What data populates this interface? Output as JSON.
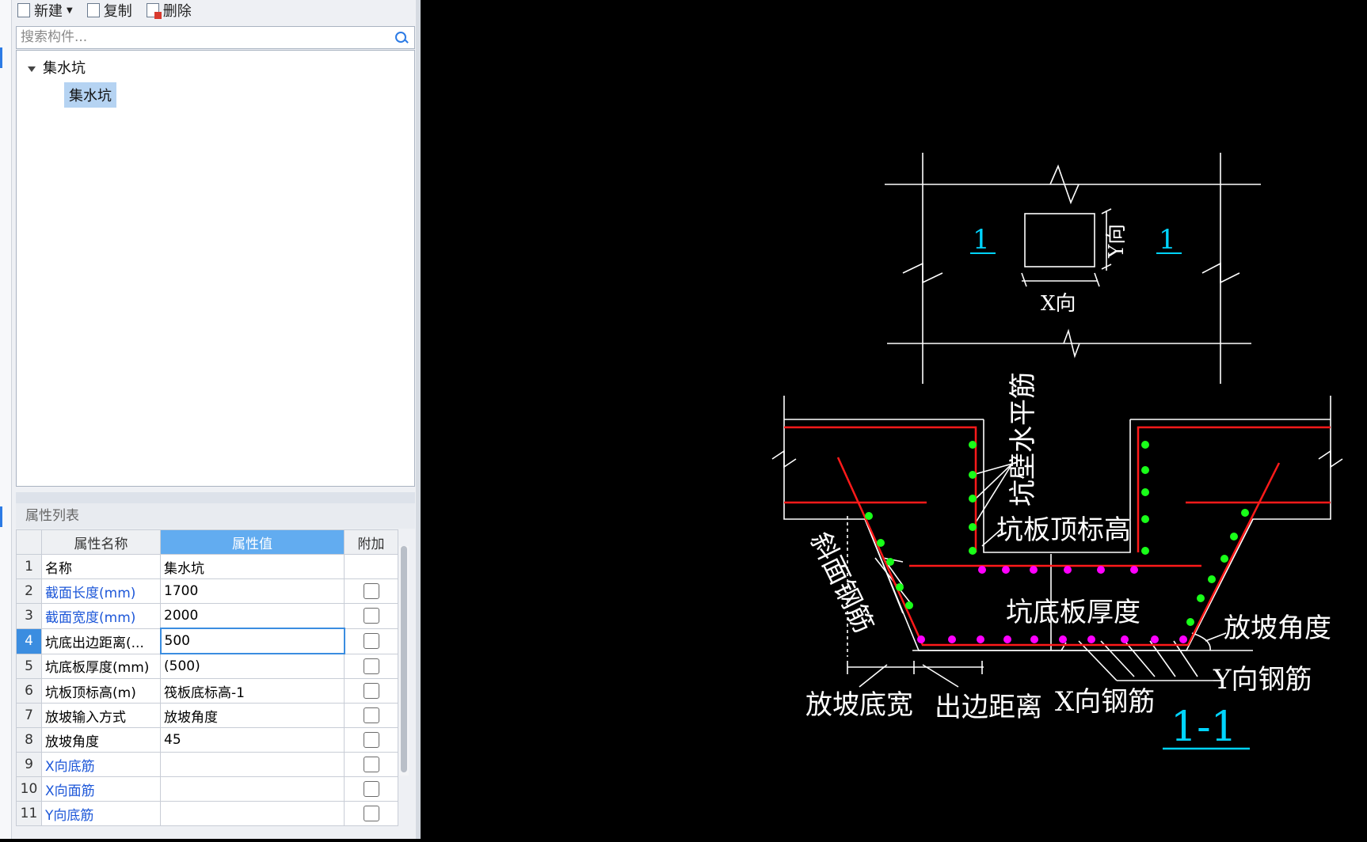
{
  "toolbar": {
    "new_label": "新建",
    "copy_label": "复制",
    "delete_label": "删除"
  },
  "search": {
    "placeholder": "搜索构件..."
  },
  "tree": {
    "root": "集水坑",
    "child": "集水坑"
  },
  "props": {
    "panel_title": "属性列表",
    "col_name": "属性名称",
    "col_value": "属性值",
    "col_extra": "附加",
    "rows": [
      {
        "idx": "1",
        "name": "名称",
        "value": "集水坑"
      },
      {
        "idx": "2",
        "name": "截面长度(mm)",
        "value": "1700"
      },
      {
        "idx": "3",
        "name": "截面宽度(mm)",
        "value": "2000"
      },
      {
        "idx": "4",
        "name": "坑底出边距离(...",
        "value": "500"
      },
      {
        "idx": "5",
        "name": "坑底板厚度(mm)",
        "value": "(500)"
      },
      {
        "idx": "6",
        "name": "坑板顶标高(m)",
        "value": "筏板底标高-1"
      },
      {
        "idx": "7",
        "name": "放坡输入方式",
        "value": "放坡角度"
      },
      {
        "idx": "8",
        "name": "放坡角度",
        "value": "45"
      },
      {
        "idx": "9",
        "name": "X向底筋",
        "value": ""
      },
      {
        "idx": "10",
        "name": "X向面筋",
        "value": ""
      },
      {
        "idx": "11",
        "name": "Y向底筋",
        "value": ""
      }
    ]
  },
  "drawing": {
    "plan_mark": "1",
    "plan_y_dir": "Y向",
    "plan_x_dir": "X向",
    "wall_horiz_rebar": "坑壁水平筋",
    "top_elev": "坑板顶标高",
    "slope_rebar": "斜面钢筋",
    "bottom_thickness": "坑底板厚度",
    "slope_angle": "放坡角度",
    "y_rebar": "Y向钢筋",
    "x_rebar": "X向钢筋",
    "slope_width": "放坡底宽",
    "edge_distance": "出边距离",
    "section": "1-1"
  },
  "colors": {
    "rebar_red": "#ff1a1a",
    "rebar_green": "#19ff19",
    "rebar_magenta": "#ff00ff",
    "mark_cyan": "#00d4ff",
    "line_white": "#ffffff"
  }
}
